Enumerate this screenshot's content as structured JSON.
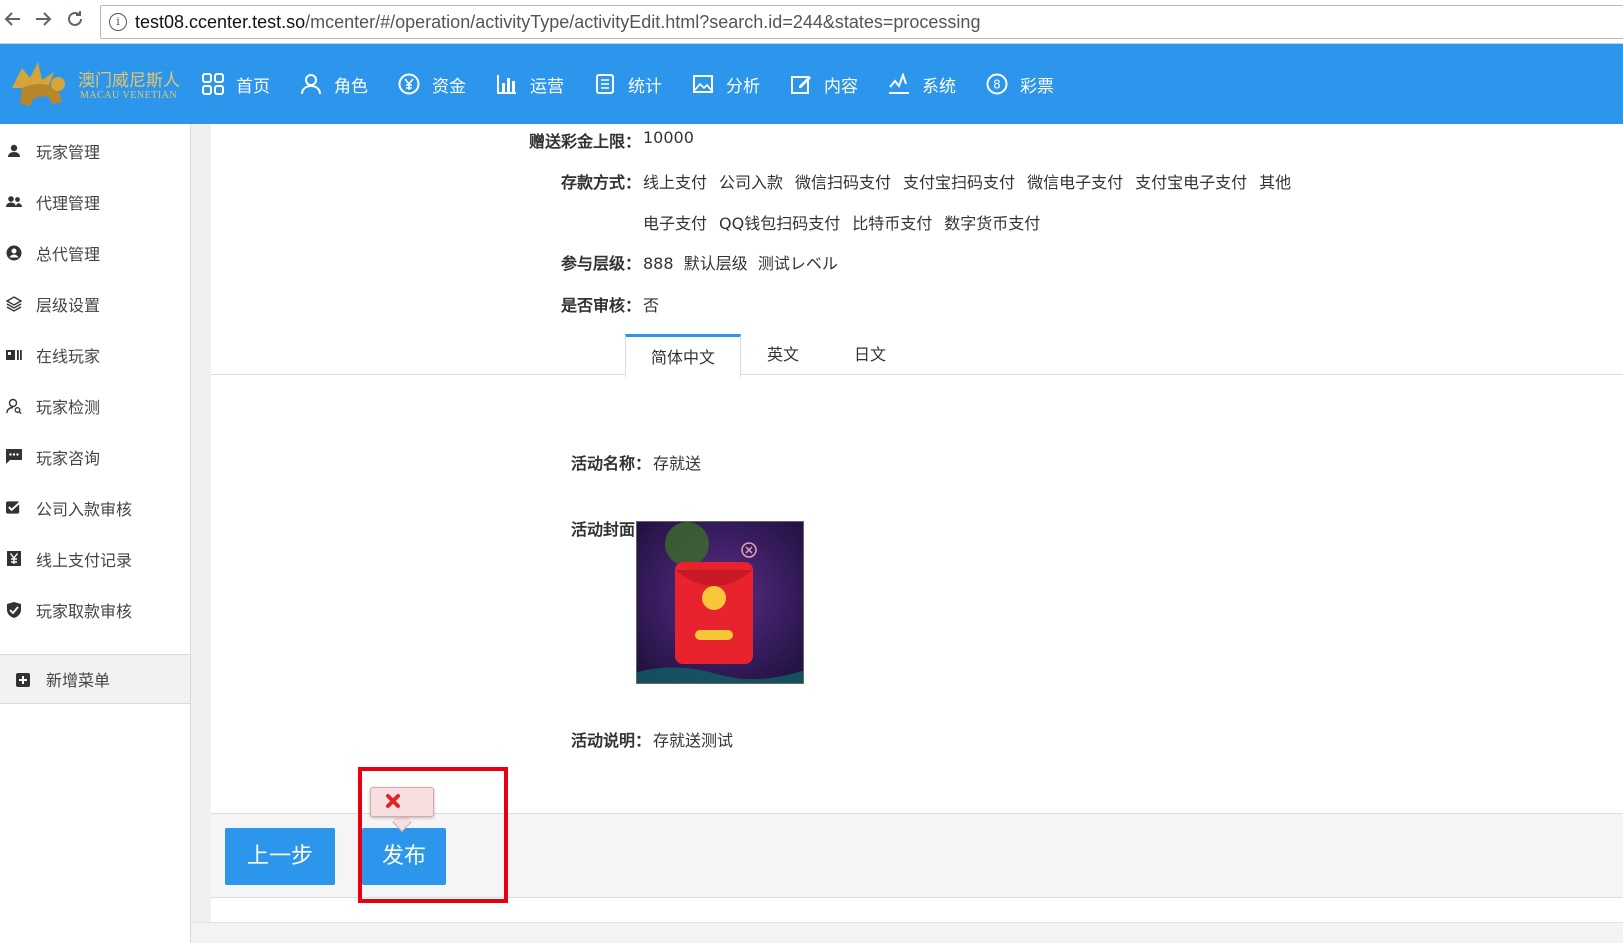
{
  "browser": {
    "url_host": "test08.ccenter.test.so",
    "url_path": "/mcenter/#/operation/activityType/activityEdit.html?search.id=244&states=processing",
    "back_icon": "arrow-left-icon",
    "forward_icon": "arrow-right-icon",
    "reload_icon": "reload-icon"
  },
  "header": {
    "logo_cn": "澳门威尼斯人",
    "logo_en": "MACAU VENETIAN",
    "nav": [
      {
        "label": "首页",
        "icon": "grid-icon"
      },
      {
        "label": "角色",
        "icon": "user-icon"
      },
      {
        "label": "资金",
        "icon": "yen-icon"
      },
      {
        "label": "运营",
        "icon": "bar-chart-icon"
      },
      {
        "label": "统计",
        "icon": "list-icon"
      },
      {
        "label": "分析",
        "icon": "image-icon"
      },
      {
        "label": "内容",
        "icon": "edit-icon"
      },
      {
        "label": "系统",
        "icon": "system-icon"
      },
      {
        "label": "彩票",
        "icon": "lottery-icon"
      }
    ]
  },
  "sidebar": {
    "items": [
      {
        "label": "玩家管理",
        "icon": "user-icon"
      },
      {
        "label": "代理管理",
        "icon": "users-icon"
      },
      {
        "label": "总代管理",
        "icon": "user-circle-icon"
      },
      {
        "label": "层级设置",
        "icon": "layers-icon"
      },
      {
        "label": "在线玩家",
        "icon": "id-card-icon"
      },
      {
        "label": "玩家检测",
        "icon": "user-search-icon"
      },
      {
        "label": "玩家咨询",
        "icon": "chat-icon"
      },
      {
        "label": "公司入款审核",
        "icon": "check-icon"
      },
      {
        "label": "线上支付记录",
        "icon": "yen-square-icon"
      },
      {
        "label": "玩家取款审核",
        "icon": "shield-check-icon"
      }
    ],
    "add_menu": "新增菜单",
    "add_icon": "plus-square-icon"
  },
  "form": {
    "bonus_limit_label": "赠送彩金上限：",
    "bonus_limit_value": "10000",
    "deposit_label": "存款方式：",
    "deposit_methods_row1": [
      "线上支付",
      "公司入款",
      "微信扫码支付",
      "支付宝扫码支付",
      "微信电子支付",
      "支付宝电子支付",
      "其他"
    ],
    "deposit_methods_row2": [
      "电子支付",
      "QQ钱包扫码支付",
      "比特币支付",
      "数字货币支付"
    ],
    "level_label": "参与层级：",
    "levels": "888  默认层级  测试レベル",
    "review_label": "是否审核：",
    "review_value": "否"
  },
  "tabs": [
    {
      "label": "简体中文",
      "active": true
    },
    {
      "label": "英文",
      "active": false
    },
    {
      "label": "日文",
      "active": false
    }
  ],
  "activity": {
    "name_label": "活动名称：",
    "name_value": "存就送",
    "cover_label": "活动封面：",
    "desc_label": "活动说明：",
    "desc_value": "存就送测试"
  },
  "buttons": {
    "prev": "上一步",
    "publish": "发布"
  },
  "colors": {
    "accent": "#2b96ec",
    "highlight": "#e60012"
  }
}
